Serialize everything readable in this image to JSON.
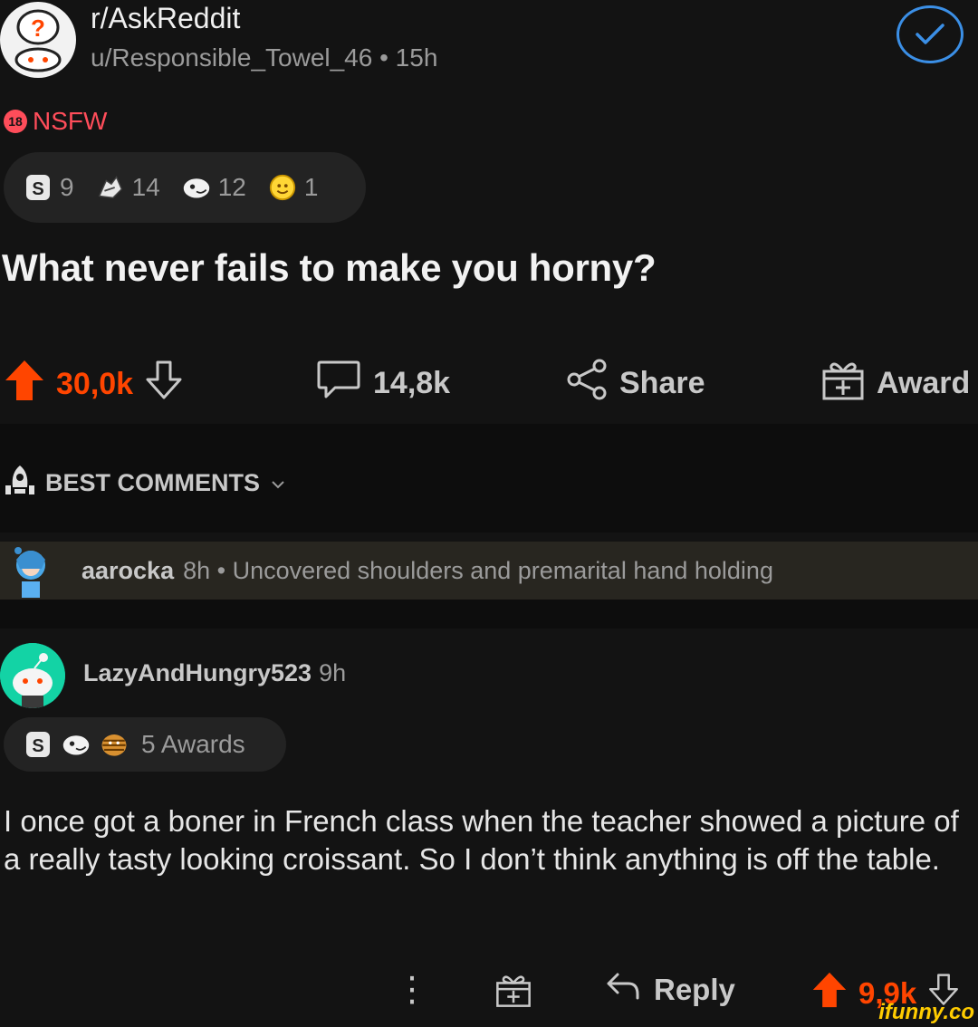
{
  "post": {
    "subreddit": "r/AskReddit",
    "author_meta": "u/Responsible_Towel_46 • 15h",
    "nsfw_badge": "18",
    "nsfw_label": "NSFW",
    "awards": [
      {
        "icon": "silver-award-icon",
        "count": "9"
      },
      {
        "icon": "helpful-award-icon",
        "count": "14"
      },
      {
        "icon": "wholesome-award-icon",
        "count": "12"
      },
      {
        "icon": "gold-award-icon",
        "count": "1"
      }
    ],
    "title": "What never fails to make you horny?",
    "upvotes": "30,0k",
    "comments": "14,8k",
    "share_label": "Share",
    "award_label": "Award"
  },
  "sort": {
    "label": "BEST COMMENTS"
  },
  "collapsed_comment": {
    "user": "aarocka",
    "rest": "8h • Uncovered shoulders and premarital hand holding"
  },
  "comment": {
    "user": "LazyAndHungry523",
    "age": "9h",
    "awards_label": "5 Awards",
    "award_icons": [
      "silver-award-icon",
      "wholesome-award-icon",
      "mummy-award-icon"
    ],
    "body": "I once got a boner in French class when the teacher showed a picture of a really tasty looking croissant. So I don’t think anything is off the table.",
    "reply_label": "Reply",
    "votes": "9,9k"
  },
  "watermark": "ifunny.co",
  "colors": {
    "upvote": "#ff4500",
    "nsfw": "#ff4d5a",
    "join": "#3b8fe6",
    "background": "#131313"
  }
}
